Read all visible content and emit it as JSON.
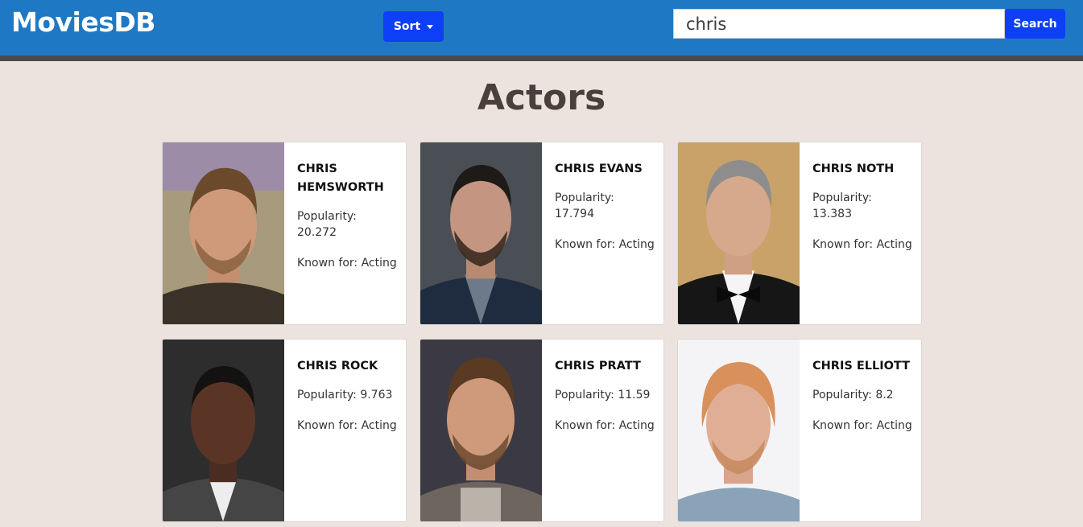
{
  "header": {
    "brand": "MoviesDB",
    "sort_label": "Sort",
    "search_value": "chris",
    "search_button": "Search"
  },
  "main": {
    "title": "Actors",
    "popularity_prefix": "Popularity: ",
    "known_for_prefix": "Known for: ",
    "actors": [
      {
        "name": "Chris Hemsworth",
        "popularity": "20.272",
        "known_for": "Acting"
      },
      {
        "name": "Chris Evans",
        "popularity": "17.794",
        "known_for": "Acting"
      },
      {
        "name": "Chris Noth",
        "popularity": "13.383",
        "known_for": "Acting"
      },
      {
        "name": "Chris Rock",
        "popularity": "9.763",
        "known_for": "Acting"
      },
      {
        "name": "Chris Pratt",
        "popularity": "11.59",
        "known_for": "Acting"
      },
      {
        "name": "Chris Elliott",
        "popularity": "8.2",
        "known_for": "Acting"
      }
    ]
  },
  "colors": {
    "navbar": "#1f78c4",
    "accent_button": "#0d3ff7",
    "page_background": "#ece3df"
  }
}
